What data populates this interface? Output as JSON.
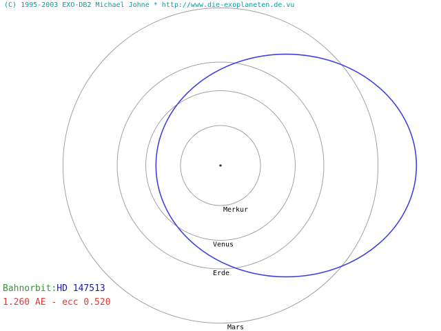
{
  "copyright": "(C) 1995-2003 EXO-DB2 Michael Johne * http://www.die-exoplaneten.de.vu",
  "star": "HD 147513",
  "legend": {
    "orbit_label": "Bahnorbit:",
    "orbit_value": "HD 147513",
    "params": "1.260 AE - ecc 0.520"
  },
  "planets": [
    {
      "name": "Merkur",
      "a_au": 0.387
    },
    {
      "name": "Venus",
      "a_au": 0.723
    },
    {
      "name": "Erde",
      "a_au": 1.0
    },
    {
      "name": "Mars",
      "a_au": 1.524
    }
  ],
  "orbit": {
    "a_au": 1.26,
    "ecc": 0.52
  },
  "colors": {
    "orbit": "#4040dd",
    "planet_orbits": "#a0a0a0",
    "copyright": "#00a0a0",
    "legend_label": "#2e9a2e",
    "legend_name": "#1a1aa8",
    "legend_params": "#e03a3a"
  }
}
